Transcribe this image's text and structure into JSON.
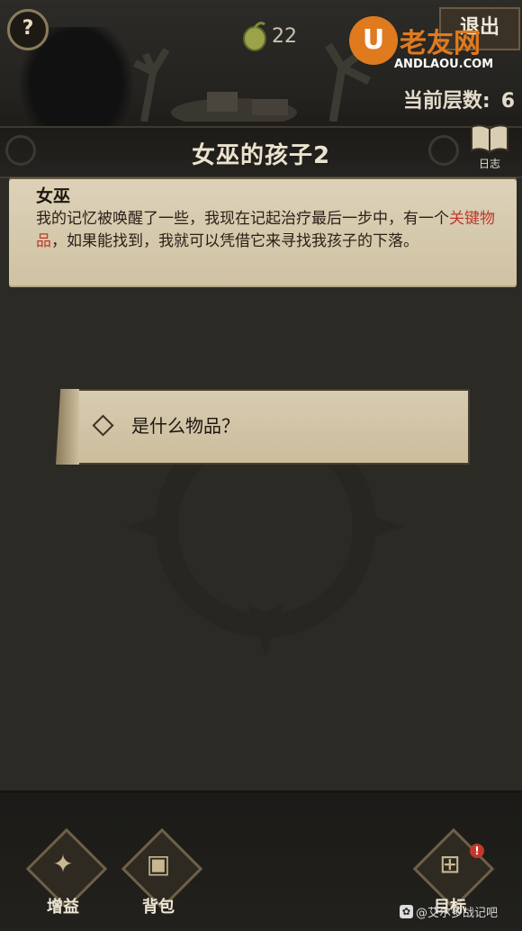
{
  "header": {
    "help_label": "?",
    "currency_value": "22",
    "exit_label": "退出",
    "logo_text": "老友网",
    "logo_letter": "U",
    "logo_sub": "ANDLAOU.COM",
    "floor_label": "当前层数:",
    "floor_value": "6"
  },
  "title_bar": {
    "title": "女巫的孩子2",
    "journal_label": "日志"
  },
  "dialog": {
    "speaker": "女巫",
    "text_part1": "我的记忆被唤醒了一些，我现在记起治疗最后一步中，有一个",
    "highlight": "关键物品",
    "text_part2": "，如果能找到，我就可以凭借它来寻找我孩子的下落。"
  },
  "choices": [
    {
      "label": "是什么物品？"
    }
  ],
  "bottom_nav": {
    "buff_label": "增益",
    "bag_label": "背包",
    "goal_label": "目标",
    "goal_badge": "!"
  },
  "watermark": "@艾尔多战记吧",
  "colors": {
    "highlight": "#c0392b",
    "parchment": "#d6cab0",
    "background": "#2b2a25"
  }
}
